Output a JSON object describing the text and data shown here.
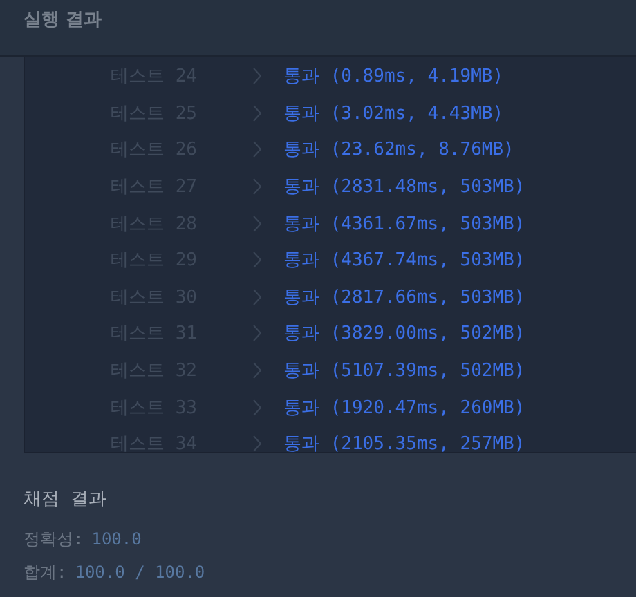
{
  "header": {
    "title": "실행 결과"
  },
  "tests": [
    {
      "label": "테스트 24",
      "result": "통과 (0.89ms, 4.19MB)"
    },
    {
      "label": "테스트 25",
      "result": "통과 (3.02ms, 4.43MB)"
    },
    {
      "label": "테스트 26",
      "result": "통과 (23.62ms, 8.76MB)"
    },
    {
      "label": "테스트 27",
      "result": "통과 (2831.48ms, 503MB)"
    },
    {
      "label": "테스트 28",
      "result": "통과 (4361.67ms, 503MB)"
    },
    {
      "label": "테스트 29",
      "result": "통과 (4367.74ms, 503MB)"
    },
    {
      "label": "테스트 30",
      "result": "통과 (2817.66ms, 503MB)"
    },
    {
      "label": "테스트 31",
      "result": "통과 (3829.00ms, 502MB)"
    },
    {
      "label": "테스트 32",
      "result": "통과 (5107.39ms, 502MB)"
    },
    {
      "label": "테스트 33",
      "result": "통과 (1920.47ms, 260MB)"
    },
    {
      "label": "테스트 34",
      "result": "통과 (2105.35ms, 257MB)"
    }
  ],
  "grading": {
    "title": "채점 결과",
    "lines": [
      {
        "label": "정확성:",
        "value": "100.0"
      },
      {
        "label": "합계:",
        "value": "100.0 / 100.0"
      }
    ]
  }
}
